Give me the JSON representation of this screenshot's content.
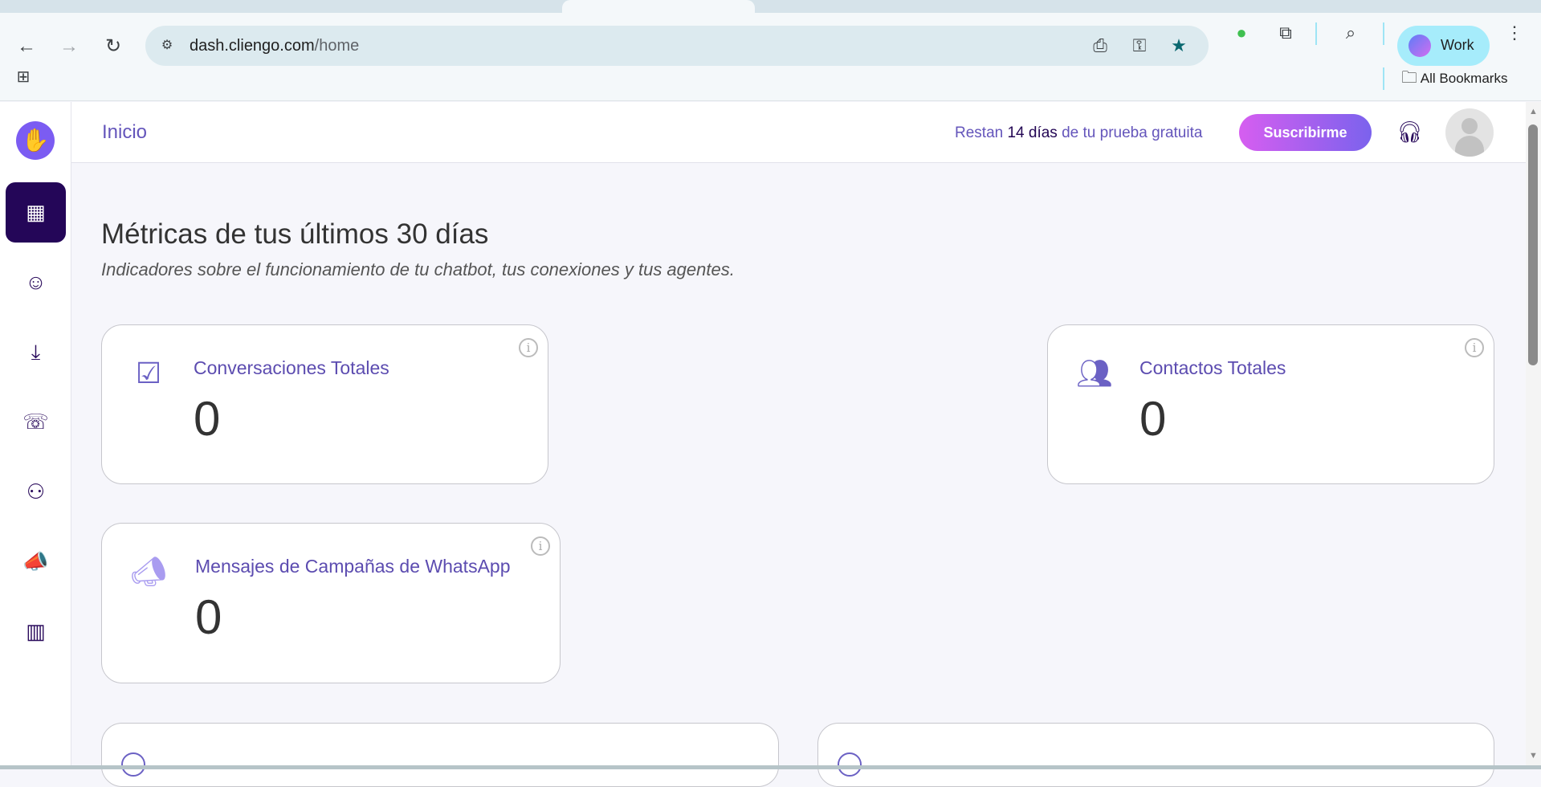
{
  "browser": {
    "url_host": "dash.cliengo.com",
    "url_path": "/home",
    "profile_label": "Work",
    "bookmarks_label": "All Bookmarks"
  },
  "header": {
    "breadcrumb": "Inicio",
    "trial_prefix": "Restan ",
    "trial_days": "14 días",
    "trial_suffix": " de tu prueba gratuita",
    "subscribe_label": "Suscribirme"
  },
  "sidebar": {
    "items": [
      {
        "name": "dashboard",
        "icon": "dashboard-icon",
        "active": true
      },
      {
        "name": "chatbot",
        "icon": "robot-icon"
      },
      {
        "name": "inbox",
        "icon": "inbox-icon"
      },
      {
        "name": "contacts",
        "icon": "phonebook-icon"
      },
      {
        "name": "team",
        "icon": "users-icon"
      },
      {
        "name": "campaigns",
        "icon": "megaphone-icon"
      },
      {
        "name": "reports",
        "icon": "bar-chart-icon"
      }
    ]
  },
  "main": {
    "title": "Métricas de tus últimos 30 días",
    "subtitle": "Indicadores sobre el funcionamiento de tu chatbot, tus conexiones y tus agentes.",
    "cards": [
      {
        "label": "Conversaciones Totales",
        "value": "0",
        "icon": "chat-check-icon"
      },
      {
        "label": "Contactos Totales",
        "value": "0",
        "icon": "contacts-icon"
      },
      {
        "label": "Mensajes de Campañas de WhatsApp",
        "value": "0",
        "icon": "megaphone-icon"
      }
    ]
  },
  "colors": {
    "accent": "#6455bb",
    "sidebar_active": "#240658",
    "subscribe_from": "#d65ef0",
    "subscribe_to": "#7b62ed"
  }
}
